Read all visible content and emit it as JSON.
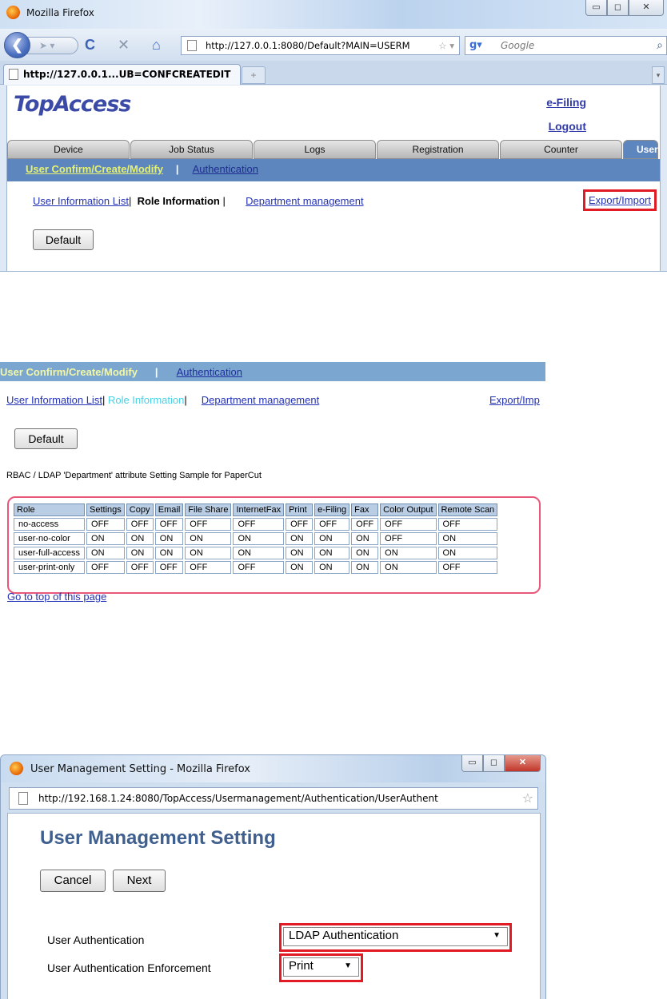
{
  "panel1": {
    "window_title": "Mozilla Firefox",
    "window_buttons": [
      "▭",
      "◻",
      "✕"
    ],
    "url": "http://127.0.0.1:8080/Default?MAIN=USERM",
    "search_placeholder": "Google",
    "tab_title": "http://127.0.0.1...UB=CONFCREATEDIT",
    "new_tab": "+",
    "logo": "TopAccess",
    "header_links": [
      "e-Filing",
      "Logout"
    ],
    "main_tabs": [
      "Device",
      "Job Status",
      "Logs",
      "Registration",
      "Counter",
      "User"
    ],
    "subnav": {
      "current": "User Confirm/Create/Modify",
      "separator": "|",
      "link": "Authentication"
    },
    "thirdnav": {
      "user_info": "User Information List",
      "role_info": "Role Information",
      "sep": "|",
      "dept": "Department management",
      "export": "Export/Import"
    },
    "default_button": "Default"
  },
  "panel2": {
    "subnav": {
      "current": "User Confirm/Create/Modify",
      "separator": "|",
      "link": "Authentication"
    },
    "thirdnav": {
      "user_info": "User Information List",
      "role_info": "Role Information",
      "sep": "|",
      "dept": "Department management",
      "export": "Export/Imp"
    },
    "default_button": "Default",
    "sample_text": "RBAC / LDAP 'Department' attribute Setting Sample for PaperCut",
    "table": {
      "headers": [
        "Role",
        "Settings",
        "Copy",
        "Email",
        "File Share",
        "InternetFax",
        "Print",
        "e-Filing",
        "Fax",
        "Color Output",
        "Remote Scan"
      ],
      "rows": [
        [
          "no-access",
          "OFF",
          "OFF",
          "OFF",
          "OFF",
          "OFF",
          "OFF",
          "OFF",
          "OFF",
          "OFF",
          "OFF"
        ],
        [
          "user-no-color",
          "ON",
          "ON",
          "ON",
          "ON",
          "ON",
          "ON",
          "ON",
          "ON",
          "OFF",
          "ON"
        ],
        [
          "user-full-access",
          "ON",
          "ON",
          "ON",
          "ON",
          "ON",
          "ON",
          "ON",
          "ON",
          "ON",
          "ON"
        ],
        [
          "user-print-only",
          "OFF",
          "OFF",
          "OFF",
          "OFF",
          "OFF",
          "ON",
          "ON",
          "ON",
          "ON",
          "OFF"
        ]
      ]
    },
    "go_top": "Go to top of this page"
  },
  "panel3": {
    "window_title": "User Management Setting - Mozilla Firefox",
    "url": "http://192.168.1.24:8080/TopAccess/Usermanagement/Authentication/UserAuthent",
    "heading": "User Management Setting",
    "cancel_button": "Cancel",
    "next_button": "Next",
    "auth_label": "User Authentication",
    "auth_value": "LDAP Authentication",
    "enforce_label": "User Authentication Enforcement",
    "enforce_value": "Print"
  },
  "colors": {
    "accent_blue": "#5d86bf",
    "highlight_red": "#e11b24",
    "table_outline": "#e8577a"
  }
}
